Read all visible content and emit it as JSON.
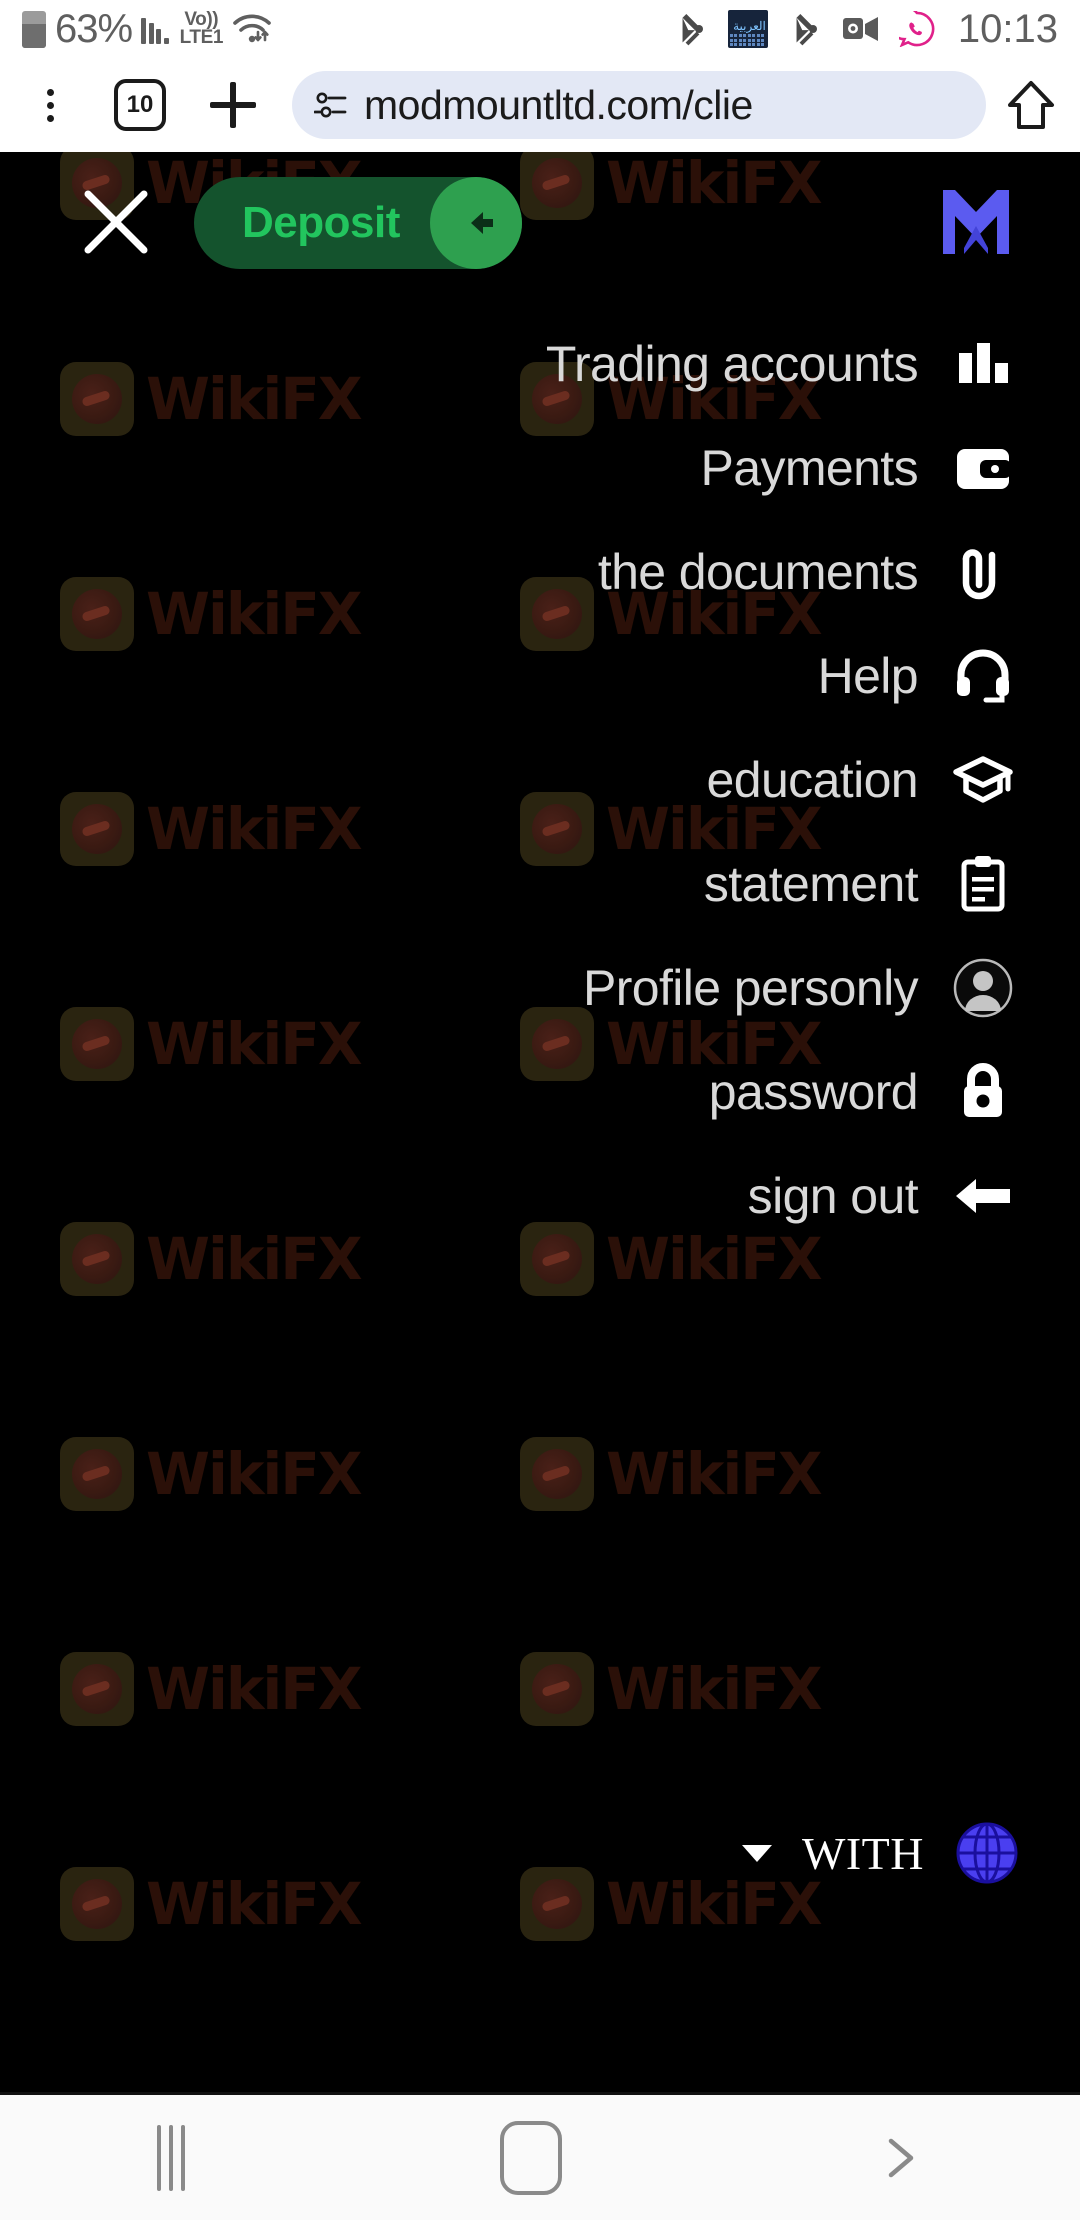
{
  "statusbar": {
    "battery_percent": "63%",
    "network_label_top": "Vo))",
    "network_label_bottom": "LTE1",
    "time": "10:13",
    "icons": [
      "battery-icon",
      "signal-bars-icon",
      "volte-icon",
      "wifi-icon",
      "kucoin-icon",
      "arabic-keyboard-icon",
      "kucoin-icon",
      "outlook-meeting-icon",
      "whatsapp-icon"
    ]
  },
  "browser": {
    "menu_icon": "more-vertical-icon",
    "tab_count": "10",
    "new_tab_icon": "plus-icon",
    "page_info_icon": "page-info-icon",
    "url": "modmountltd.com/clie",
    "home_icon": "home-icon"
  },
  "app": {
    "close_label": "close-icon",
    "deposit_label": "Deposit",
    "deposit_arrow_icon": "arrow-left-icon",
    "logo_name": "modmount-m-logo",
    "colors": {
      "deposit_pill_bg": "#14532d",
      "deposit_text": "#22c55e",
      "deposit_circle": "#2ea04f",
      "logo": "#5b5bf0",
      "globe": "#4a3ff0",
      "background": "#000000",
      "menu_text": "#d9d9d9"
    },
    "menu": [
      {
        "label": "Trading accounts",
        "icon": "bar-chart-icon"
      },
      {
        "label": "Payments",
        "icon": "wallet-icon"
      },
      {
        "label": "the documents",
        "icon": "paperclip-icon"
      },
      {
        "label": "Help",
        "icon": "headset-icon"
      },
      {
        "label": "education",
        "icon": "graduation-cap-icon"
      },
      {
        "label": "statement",
        "icon": "clipboard-icon"
      },
      {
        "label": "Profile personly",
        "icon": "user-avatar-icon"
      },
      {
        "label": "password",
        "icon": "lock-icon"
      },
      {
        "label": "sign out",
        "icon": "arrow-left-solid-icon"
      }
    ],
    "language": {
      "label": "WITH",
      "chevron_icon": "chevron-down-icon",
      "globe_icon": "globe-icon"
    },
    "watermark_text": "WikiFX"
  },
  "navbar": {
    "recents_icon": "recents-icon",
    "home_icon": "home-square-icon",
    "forward_icon": "chevron-right-icon"
  }
}
